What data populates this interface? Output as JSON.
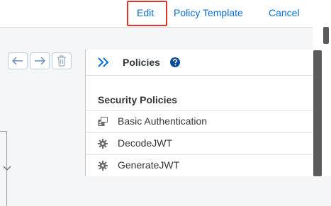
{
  "toolbar": {
    "edit_label": "Edit",
    "policy_template_label": "Policy Template",
    "cancel_label": "Cancel",
    "link_color": "#0a6ed1",
    "highlight_color": "#e0322b"
  },
  "canvas_toolbar": {
    "buttons": [
      {
        "icon": "arrow-left-icon"
      },
      {
        "icon": "arrow-right-icon"
      },
      {
        "icon": "trash-icon"
      }
    ]
  },
  "policies_panel": {
    "title": "Policies",
    "collapse_icon": "double-chevron-right-icon",
    "help_icon": "question-circle-icon",
    "section_title": "Security Policies",
    "items": [
      {
        "label": "Basic Authentication",
        "icon": "id-card-icon"
      },
      {
        "label": "DecodeJWT",
        "icon": "gear-icon"
      },
      {
        "label": "GenerateJWT",
        "icon": "gear-icon"
      }
    ]
  }
}
